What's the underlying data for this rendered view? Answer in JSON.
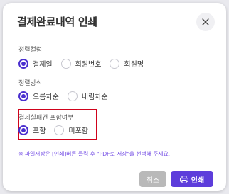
{
  "dialog": {
    "title": "결제완료내역 인쇄",
    "close_icon": "close-icon"
  },
  "sort_column": {
    "label": "정렬컬럼",
    "options": [
      "결제일",
      "회원번호",
      "회원명"
    ],
    "selected": "결제일"
  },
  "sort_order": {
    "label": "정렬방식",
    "options": [
      "오름차순",
      "내림차순"
    ],
    "selected": "오름차순"
  },
  "include_failed": {
    "label": "결제실패건 포함여부",
    "options": [
      "포함",
      "미포함"
    ],
    "selected": "포함"
  },
  "note": "※ 파일저장은 [인쇄]버튼 클릭 후 \"PDF로 저장\"을 선택해 주세요.",
  "buttons": {
    "cancel_label": "취소",
    "print_label": "인쇄",
    "print_icon": "printer-icon"
  },
  "colors": {
    "accent": "#5d3ddb",
    "radio_checked": "#4a2fcf",
    "highlight_border": "#d0021b",
    "note_text": "#7a55e6",
    "cancel_bg": "#b9b9b9"
  }
}
